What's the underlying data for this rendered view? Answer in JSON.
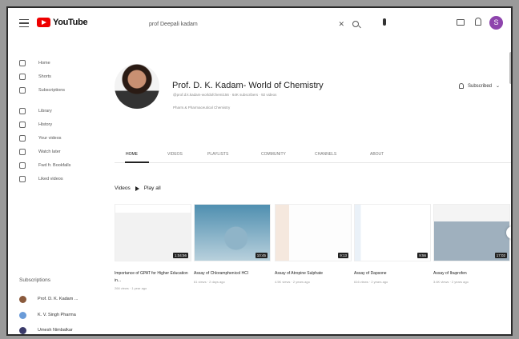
{
  "header": {
    "logo_text": "YouTube",
    "search_query": "prof Deepali kadam",
    "avatar_letter": "S"
  },
  "sidebar": {
    "items": [
      {
        "label": "Home",
        "icon": "home-icon"
      },
      {
        "label": "Shorts",
        "icon": "shorts-icon"
      },
      {
        "label": "Subscriptions",
        "icon": "subscriptions-icon"
      },
      {
        "label": "Library",
        "icon": "library-icon"
      },
      {
        "label": "History",
        "icon": "history-icon"
      },
      {
        "label": "Your videos",
        "icon": "your-videos-icon"
      },
      {
        "label": "Watch later",
        "icon": "watch-later-icon"
      },
      {
        "label": "Fwd fr. Bookfalls",
        "icon": "playlist-icon"
      },
      {
        "label": "Liked videos",
        "icon": "liked-videos-icon"
      }
    ],
    "subscriptions_heading": "Subscriptions",
    "subscriptions": [
      {
        "label": "Prof. D. K. Kadam ...",
        "color": "#8a5a3c"
      },
      {
        "label": "K. V. Singh Pharma",
        "color": "#6a9bd8"
      },
      {
        "label": "Umesh Nimbalkar",
        "color": "#3a3a6a"
      }
    ]
  },
  "channel": {
    "name": "Prof. D. K. Kadam- World of Chemistry",
    "meta": "@prof.d.k.kadam-worldofchemi156 · 64K subscribers · 92 videos",
    "link": "Pharm.& Pharmaceutical Chemistry",
    "subscribe_label": "Subscribed"
  },
  "tabs": [
    "HOME",
    "VIDEOS",
    "PLAYLISTS",
    "COMMUNITY",
    "CHANNELS",
    "ABOUT"
  ],
  "videos_heading": "Videos",
  "play_all": "Play all",
  "videos": [
    {
      "title": "Importance of GPAT for Higher Education in...",
      "meta": "266 views · 1 year ago",
      "duration": "1:04:56"
    },
    {
      "title": "Assay of Chloramphenicol HCl",
      "meta": "61 views · 2 days ago",
      "duration": "10:45"
    },
    {
      "title": "Assay of Atropine Sulphate",
      "meta": "4.5K views · 2 years ago",
      "duration": "9:13"
    },
    {
      "title": "Assay of Dapsone",
      "meta": "616 views · 2 years ago",
      "duration": "9:56"
    },
    {
      "title": "Assay of Ibuprofen",
      "meta": "3.6K views · 2 years ago",
      "duration": "17:02"
    }
  ]
}
